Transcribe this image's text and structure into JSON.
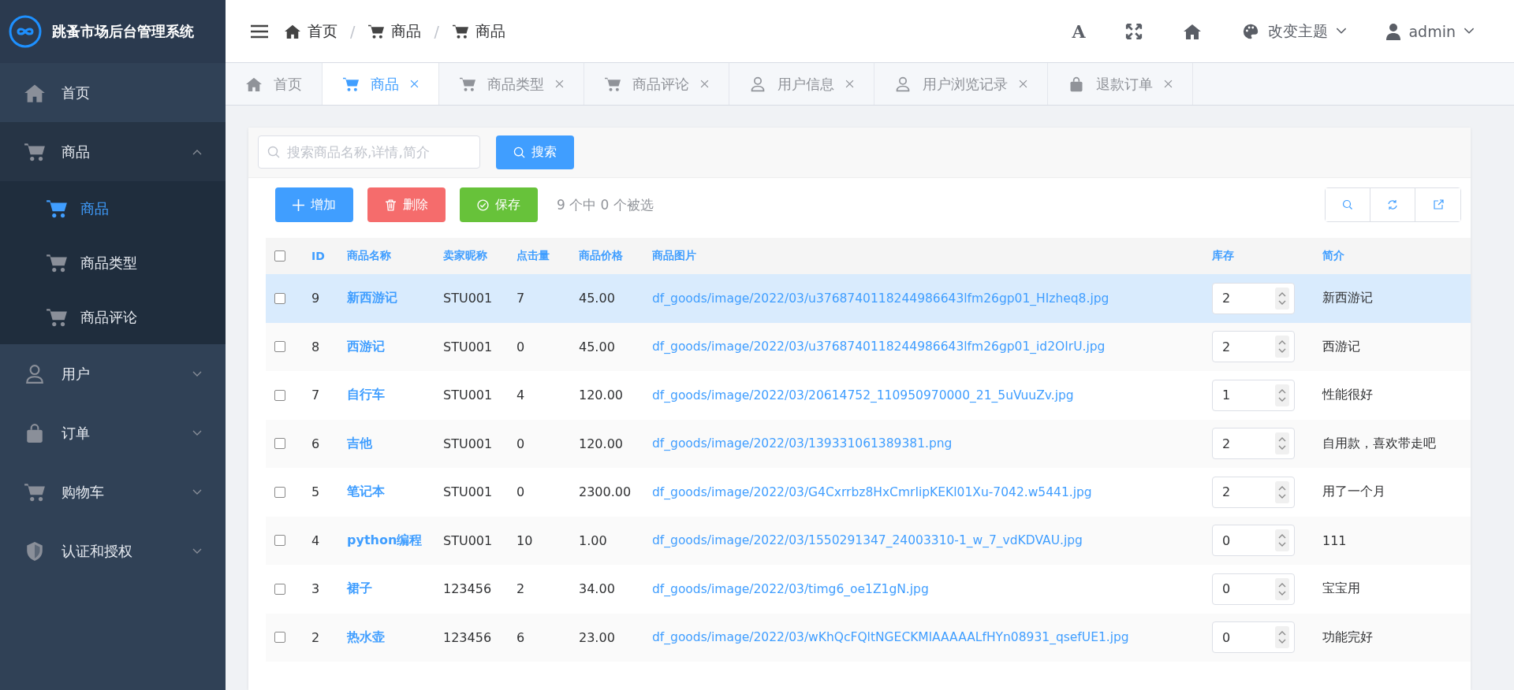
{
  "app": {
    "title": "跳蚤市场后台管理系统"
  },
  "sidebar": {
    "items": [
      {
        "label": "首页",
        "kind": "link"
      },
      {
        "label": "商品",
        "kind": "group",
        "expanded": true,
        "children": [
          {
            "label": "商品",
            "selected": true
          },
          {
            "label": "商品类型",
            "selected": false
          },
          {
            "label": "商品评论",
            "selected": false
          }
        ]
      },
      {
        "label": "用户",
        "kind": "group",
        "expanded": false
      },
      {
        "label": "订单",
        "kind": "group",
        "expanded": false
      },
      {
        "label": "购物车",
        "kind": "group",
        "expanded": false
      },
      {
        "label": "认证和授权",
        "kind": "group",
        "expanded": false
      }
    ]
  },
  "header": {
    "breadcrumb": [
      {
        "label": "首页"
      },
      {
        "separator": "/",
        "label": "商品"
      },
      {
        "separator": "/",
        "label": "商品"
      }
    ],
    "font_button": "A",
    "theme": "改变主题",
    "user": "admin"
  },
  "tabs": [
    {
      "label": "首页",
      "closable": false,
      "selected": false
    },
    {
      "label": "商品",
      "closable": true,
      "selected": true
    },
    {
      "label": "商品类型",
      "closable": true,
      "selected": false
    },
    {
      "label": "商品评论",
      "closable": true,
      "selected": false
    },
    {
      "label": "用户信息",
      "closable": true,
      "selected": false
    },
    {
      "label": "用户浏览记录",
      "closable": true,
      "selected": false
    },
    {
      "label": "退款订单",
      "closable": true,
      "selected": false
    }
  ],
  "search": {
    "placeholder": "搜索商品名称,详情,简介",
    "button": "搜索"
  },
  "toolbar": {
    "buttons": [
      {
        "label": "增加",
        "kind": "add"
      },
      {
        "label": "删除",
        "kind": "delete"
      },
      {
        "label": "保存",
        "kind": "save"
      }
    ],
    "selection": "9 个中 0 个被选"
  },
  "table": {
    "header_checked": false,
    "columns": [
      "ID",
      "商品名称",
      "卖家昵称",
      "点击量",
      "商品价格",
      "商品图片",
      "库存",
      "简介"
    ],
    "rows": [
      {
        "id": "9",
        "name": "新西游记",
        "seller": "STU001",
        "clicks": "7",
        "price": "45.00",
        "image": "df_goods/image/2022/03/u3768740118244986643lfm26gp01_HIzheq8.jpg",
        "stock": "2",
        "intro": "新西游记",
        "selected": true,
        "checked": false
      },
      {
        "id": "8",
        "name": "西游记",
        "seller": "STU001",
        "clicks": "0",
        "price": "45.00",
        "image": "df_goods/image/2022/03/u3768740118244986643lfm26gp01_id2OIrU.jpg",
        "stock": "2",
        "intro": "西游记",
        "selected": false,
        "checked": false
      },
      {
        "id": "7",
        "name": "自行车",
        "seller": "STU001",
        "clicks": "4",
        "price": "120.00",
        "image": "df_goods/image/2022/03/20614752_110950970000_21_5uVuuZv.jpg",
        "stock": "1",
        "intro": "性能很好",
        "selected": false,
        "checked": false
      },
      {
        "id": "6",
        "name": "吉他",
        "seller": "STU001",
        "clicks": "0",
        "price": "120.00",
        "image": "df_goods/image/2022/03/139331061389381.png",
        "stock": "2",
        "intro": "自用款，喜欢带走吧",
        "selected": false,
        "checked": false
      },
      {
        "id": "5",
        "name": "笔记本",
        "seller": "STU001",
        "clicks": "0",
        "price": "2300.00",
        "image": "df_goods/image/2022/03/G4Cxrrbz8HxCmrIipKEKl01Xu-7042.w5441.jpg",
        "stock": "2",
        "intro": "用了一个月",
        "selected": false,
        "checked": false
      },
      {
        "id": "4",
        "name": "python编程",
        "seller": "STU001",
        "clicks": "10",
        "price": "1.00",
        "image": "df_goods/image/2022/03/1550291347_24003310-1_w_7_vdKDVAU.jpg",
        "stock": "0",
        "intro": "111",
        "selected": false,
        "checked": false
      },
      {
        "id": "3",
        "name": "裙子",
        "seller": "123456",
        "clicks": "2",
        "price": "34.00",
        "image": "df_goods/image/2022/03/timg6_oe1Z1gN.jpg",
        "stock": "0",
        "intro": "宝宝用",
        "selected": false,
        "checked": false
      },
      {
        "id": "2",
        "name": "热水壶",
        "seller": "123456",
        "clicks": "6",
        "price": "23.00",
        "image": "df_goods/image/2022/03/wKhQcFQltNGECKMlAAAAALfHYn08931_qsefUE1.jpg",
        "stock": "0",
        "intro": "功能完好",
        "selected": false,
        "checked": false
      }
    ]
  }
}
